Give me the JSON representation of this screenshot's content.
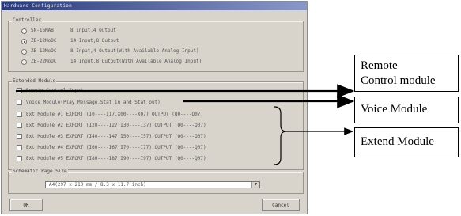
{
  "window": {
    "title": "Hardware Configuration"
  },
  "controller": {
    "title": "Controller",
    "options": [
      {
        "model": "SN-16MAB",
        "desc": "8 Input,4 Output",
        "selected": false
      },
      {
        "model": "ZB-12MoDC",
        "desc": "14 Input,8 Output",
        "selected": true
      },
      {
        "model": "ZB-12MoDC",
        "desc": "8 Input,4 Output(With Available Analog Input)",
        "selected": false
      },
      {
        "model": "ZB-22MoDC",
        "desc": "14 Input,8 Output(With Available Analog Input)",
        "selected": false
      }
    ]
  },
  "extended": {
    "title": "Extended Module",
    "items": [
      {
        "label": "Remote Control Input"
      },
      {
        "label": "Voice Module(Play Message,Stat in and Stat out)"
      },
      {
        "label": "Ext.Module #1 EXPORT (I0----I17,X00----X07) OUTPUT (Q0----Q07)"
      },
      {
        "label": "Ext.Module #2 EXPORT (I20----I27,I30----I37) OUTPUT (Q0----Q07)"
      },
      {
        "label": "Ext.Module #3 EXPORT (I40----I47,I50----I57) OUTPUT (Q0----Q07)"
      },
      {
        "label": "Ext.Module #4 EXPORT (I60----I67,I70----I77) OUTPUT (Q0----Q07)"
      },
      {
        "label": "Ext.Module #5 EXPORT (I80----I87,I90----I97) OUTPUT (Q0----Q07)"
      }
    ]
  },
  "schematic": {
    "title": "Schematic Page Size",
    "value": "A4(297 x 210 mm / 8.3 x 11.7 inch)"
  },
  "buttons": {
    "ok": "OK",
    "cancel": "Cancel"
  },
  "annotations": {
    "remote_line1": "Remote",
    "remote_line2": "Control module",
    "voice": "Voice Module",
    "extend": "Extend Module"
  }
}
